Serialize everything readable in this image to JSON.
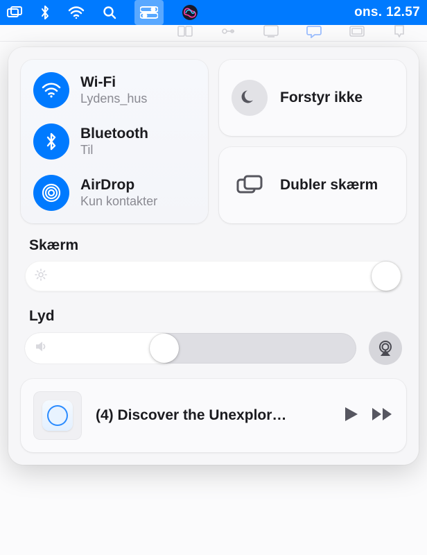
{
  "menubar": {
    "clock": "ons. 12.57"
  },
  "connectivity": {
    "wifi": {
      "title": "Wi-Fi",
      "sub": "Lydens_hus"
    },
    "bluetooth": {
      "title": "Bluetooth",
      "sub": "Til"
    },
    "airdrop": {
      "title": "AirDrop",
      "sub": "Kun kontakter"
    }
  },
  "dnd": {
    "title": "Forstyr ikke"
  },
  "mirror": {
    "title": "Dubler skærm"
  },
  "display": {
    "label": "Skærm",
    "brightness_pct": 98
  },
  "sound": {
    "label": "Lyd",
    "volume_pct": 46
  },
  "nowplaying": {
    "title": "(4) Discover the Unexplor…"
  }
}
